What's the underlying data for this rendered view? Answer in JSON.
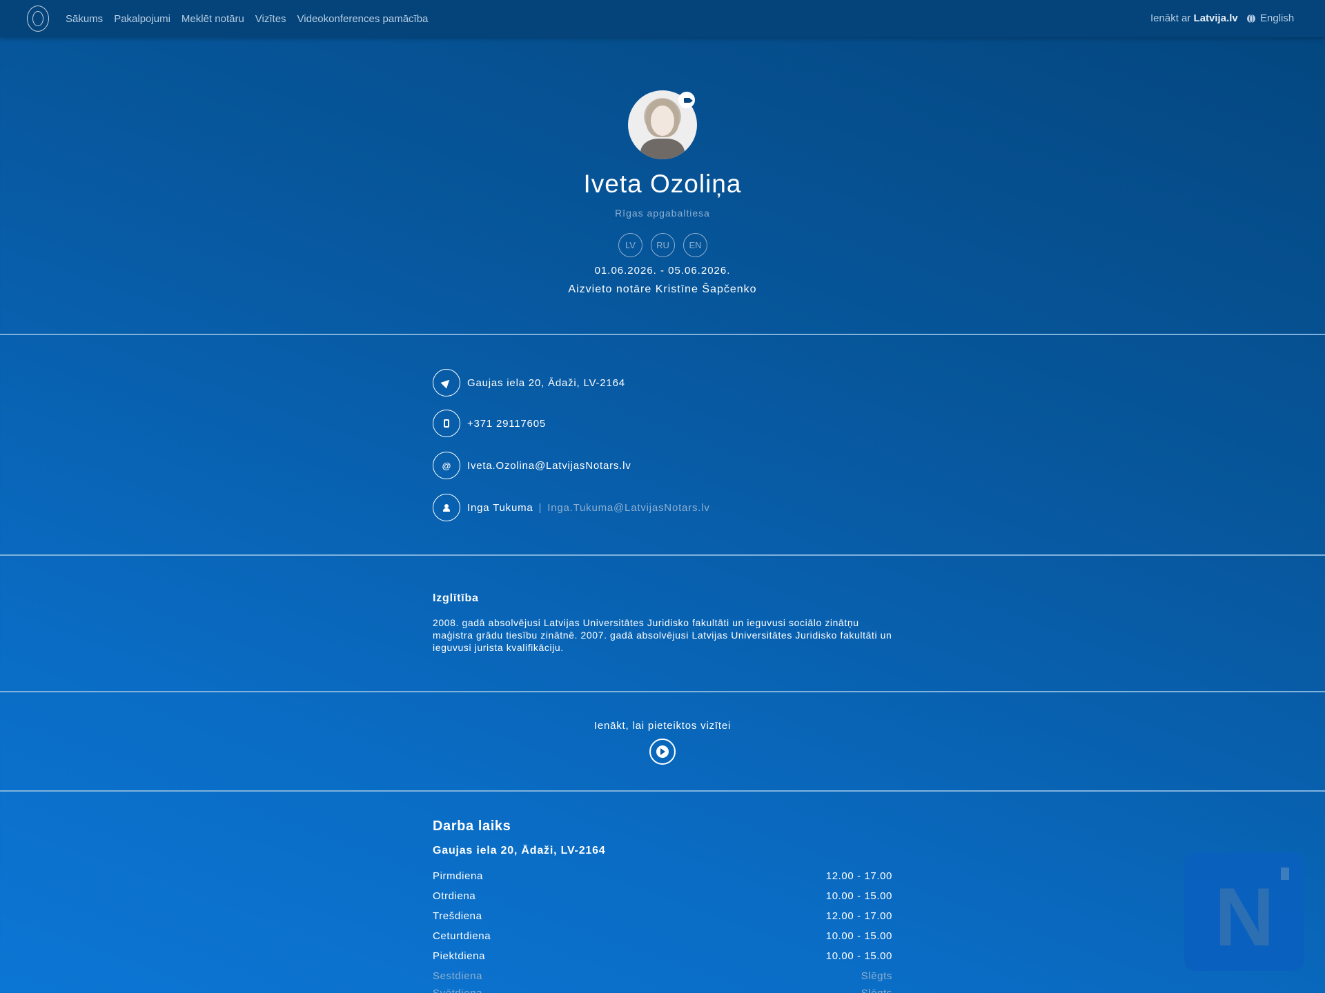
{
  "nav": {
    "items": [
      "Sākums",
      "Pakalpojumi",
      "Meklēt notāru",
      "Vizītes",
      "Videokonferences pamācība"
    ],
    "login_prefix": "Ienākt ar",
    "login_brand": "Latvija.lv",
    "language": "English"
  },
  "profile": {
    "name": "Iveta Ozoliņa",
    "court": "Rīgas apgabaltiesa",
    "languages": [
      "LV",
      "RU",
      "EN"
    ],
    "dates": "01.06.2026. - 05.06.2026.",
    "substitute": "Aizvieto notāre Kristīne Šapčenko"
  },
  "contacts": {
    "address": "Gaujas iela 20, Ādaži, LV-2164",
    "phone": "+371 29117605",
    "email": "Iveta.Ozolina@LatvijasNotars.lv",
    "email_symbol": "@",
    "assistant_name": "Inga Tukuma",
    "assistant_separator": "|",
    "assistant_email": "Inga.Tukuma@LatvijasNotars.lv"
  },
  "education": {
    "title": "Izglītība",
    "text": "2008. gadā absolvējusi Latvijas Universitātes Juridisko fakultāti un ieguvusi sociālo zinātņu maģistra grādu tiesību zinātnē. 2007. gadā absolvējusi Latvijas Universitātes Juridisko fakultāti un ieguvusi jurista kvalifikāciju."
  },
  "cta": {
    "text": "Ienākt, lai pieteiktos vizītei"
  },
  "hours": {
    "title": "Darba laiks",
    "address": "Gaujas iela 20, Ādaži, LV-2164",
    "rows": [
      {
        "day": "Pirmdiena",
        "time": "12.00 - 17.00"
      },
      {
        "day": "Otrdiena",
        "time": "10.00 - 15.00"
      },
      {
        "day": "Trešdiena",
        "time": "12.00 - 17.00"
      },
      {
        "day": "Ceturtdiena",
        "time": "10.00 - 15.00"
      },
      {
        "day": "Piektdiena",
        "time": "10.00 - 15.00"
      },
      {
        "day": "Sestdiena",
        "time": "Slēgts"
      },
      {
        "day": "Svētdiena",
        "time": "Slēgts"
      }
    ]
  },
  "brand_logo": {
    "letter": "N"
  },
  "colors": {
    "background": "#07589f",
    "muted": "#8eb0d1",
    "divider": "#7fb2dd"
  }
}
